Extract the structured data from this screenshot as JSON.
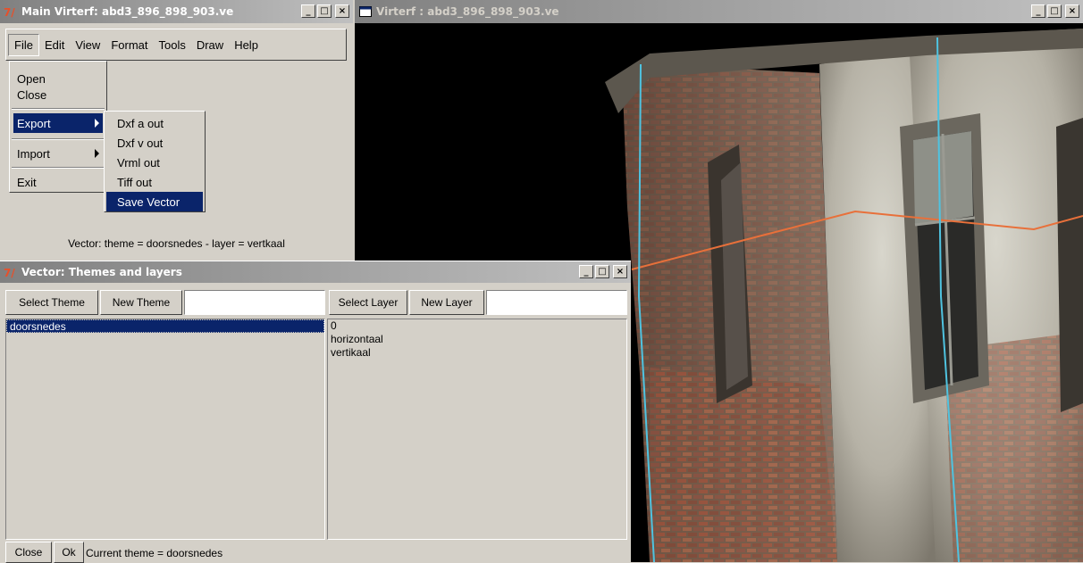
{
  "main_window": {
    "title": "Main Virterf: abd3_896_898_903.ve",
    "menu": [
      "File",
      "Edit",
      "View",
      "Format",
      "Tools",
      "Draw",
      "Help"
    ],
    "file_menu": [
      "Open",
      "Close",
      "Export",
      "Import",
      "Exit"
    ],
    "export_submenu": [
      "Dxf a out",
      "Dxf v out",
      "Vrml out",
      "Tiff out",
      "Save Vector"
    ],
    "status": "Vector: theme = doorsnedes - layer = vertkaal"
  },
  "view_window": {
    "title": "Virterf : abd3_896_898_903.ve"
  },
  "vector_window": {
    "title": "Vector: Themes and layers",
    "select_theme_label": "Select Theme",
    "new_theme_label": "New Theme",
    "new_theme_value": "",
    "select_layer_label": "Select Layer",
    "new_layer_label": "New Layer",
    "new_layer_value": "",
    "themes": [
      "doorsnedes"
    ],
    "layers": [
      "0",
      "horizontaal",
      "vertikaal"
    ],
    "close_label": "Close",
    "ok_label": "Ok",
    "current_theme": "Current theme = doorsnedes"
  },
  "window_buttons": {
    "minimize": "_",
    "maximize": "□",
    "close": "×"
  },
  "icons": {
    "app": "tk-feather-icon",
    "view": "window-icon"
  },
  "colors": {
    "titlebar_active": "#0a246a",
    "titlebar_inactive": "#808080",
    "selection": "#0a246a",
    "window_face": "#d4d0c8",
    "section_line": "#e8703a",
    "vertical_line": "#4fc3e0"
  }
}
